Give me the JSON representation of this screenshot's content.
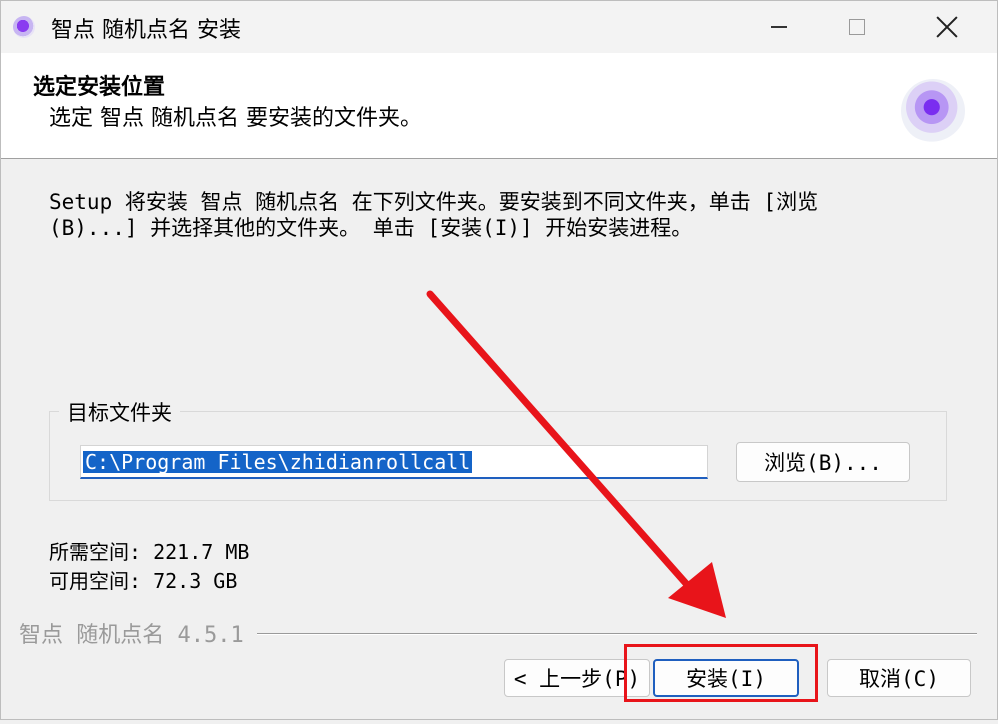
{
  "window": {
    "title": "智点 随机点名 安装"
  },
  "header": {
    "title": "选定安装位置",
    "subtitle": "选定 智点 随机点名 要安装的文件夹。"
  },
  "body": {
    "description_line1": "Setup 将安装 智点 随机点名 在下列文件夹。要安装到不同文件夹，单击 [浏览",
    "description_line2": "(B)...] 并选择其他的文件夹。 单击 [安装(I)] 开始安装进程。",
    "dest_group_label": "目标文件夹",
    "dest_path": "C:\\Program Files\\zhidianrollcall",
    "browse_label": "浏览(B)...",
    "space_required": "所需空间: 221.7 MB",
    "space_available": "可用空间: 72.3 GB"
  },
  "footer": {
    "brand": "智点 随机点名 4.5.1",
    "back_label": "< 上一步(P)",
    "install_label": "安装(I)",
    "cancel_label": "取消(C)"
  },
  "annotation": {
    "color": "#e8141a"
  }
}
